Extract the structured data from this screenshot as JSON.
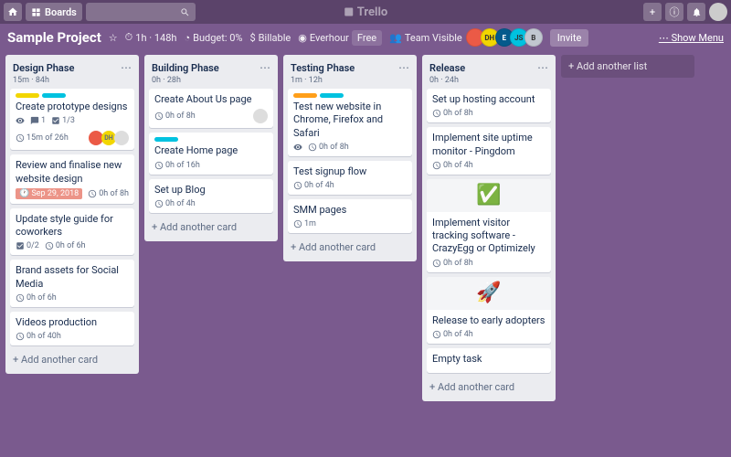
{
  "topbar": {
    "boards": "Boards",
    "logo": "Trello"
  },
  "board": {
    "title": "Sample Project",
    "time": "1h · 148h",
    "budget": "Budget: 0%",
    "billable": "Billable",
    "everhour": "Everhour",
    "free": "Free",
    "visibility": "Team Visible",
    "invite": "Invite",
    "showMenu": "Show Menu"
  },
  "members": [
    {
      "bg": "#eb5a46",
      "txt": ""
    },
    {
      "bg": "#f2d600",
      "txt": "DH",
      "fg": "#333"
    },
    {
      "bg": "#055a8c",
      "txt": "E"
    },
    {
      "bg": "#00c2e0",
      "txt": "JS",
      "fg": "#333"
    },
    {
      "bg": "#c1c7d0",
      "txt": "B",
      "fg": "#333"
    }
  ],
  "lists": [
    {
      "title": "Design Phase",
      "sub": "15m · 84h",
      "cards": [
        {
          "labels": [
            "#f2d600",
            "#00c2e0"
          ],
          "title": "Create prototype designs",
          "badges": [
            {
              "t": "eye"
            },
            {
              "t": "comment",
              "v": "1"
            },
            {
              "t": "check",
              "v": "1/3"
            }
          ],
          "time": "15m of 26h",
          "members": [
            {
              "bg": "#eb5a46"
            },
            {
              "bg": "#f2d600",
              "txt": "DH"
            },
            {
              "bg": "#ddd"
            }
          ]
        },
        {
          "title": "Review and finalise new website design",
          "due": "Sep 29, 2018",
          "time": "0h of 8h"
        },
        {
          "title": "Update style guide for coworkers",
          "badges": [
            {
              "t": "check",
              "v": "0/2"
            }
          ],
          "time": "0h of 6h"
        },
        {
          "title": "Brand assets for Social Media",
          "time": "0h of 6h"
        },
        {
          "title": "Videos production",
          "time": "0h of 40h"
        }
      ]
    },
    {
      "title": "Building Phase",
      "sub": "0h · 28h",
      "cards": [
        {
          "title": "Create About Us page",
          "time": "0h of 8h",
          "members": [
            {
              "bg": "#ddd"
            }
          ]
        },
        {
          "labels": [
            "#00c2e0"
          ],
          "title": "Create Home page",
          "time": "0h of 16h"
        },
        {
          "title": "Set up Blog",
          "time": "0h of 4h"
        }
      ]
    },
    {
      "title": "Testing Phase",
      "sub": "1m · 12h",
      "cards": [
        {
          "labels": [
            "#ff9f1a",
            "#00c2e0"
          ],
          "title": "Test new website in Chrome, Firefox and Safari",
          "badges": [
            {
              "t": "eye"
            }
          ],
          "time": "0h of 8h"
        },
        {
          "title": "Test signup flow",
          "time": "0h of 4h"
        },
        {
          "title": "SMM pages",
          "time": "1m"
        }
      ]
    },
    {
      "title": "Release",
      "sub": "0h · 24h",
      "cards": [
        {
          "title": "Set up hosting account",
          "time": "0h of 8h"
        },
        {
          "title": "Implement site uptime monitor - Pingdom",
          "time": "0h of 4h"
        },
        {
          "cover": "#f4f5f7",
          "emoji": "✅",
          "title": "Implement visitor tracking software - CrazyEgg or Optimizely",
          "time": "0h of 8h"
        },
        {
          "cover": "#f4f5f7",
          "emoji": "🚀",
          "title": "Release to early adopters",
          "time": "0h of 4h"
        },
        {
          "title": "Empty task"
        }
      ]
    }
  ],
  "addCard": "Add another card",
  "addList": "Add another list"
}
